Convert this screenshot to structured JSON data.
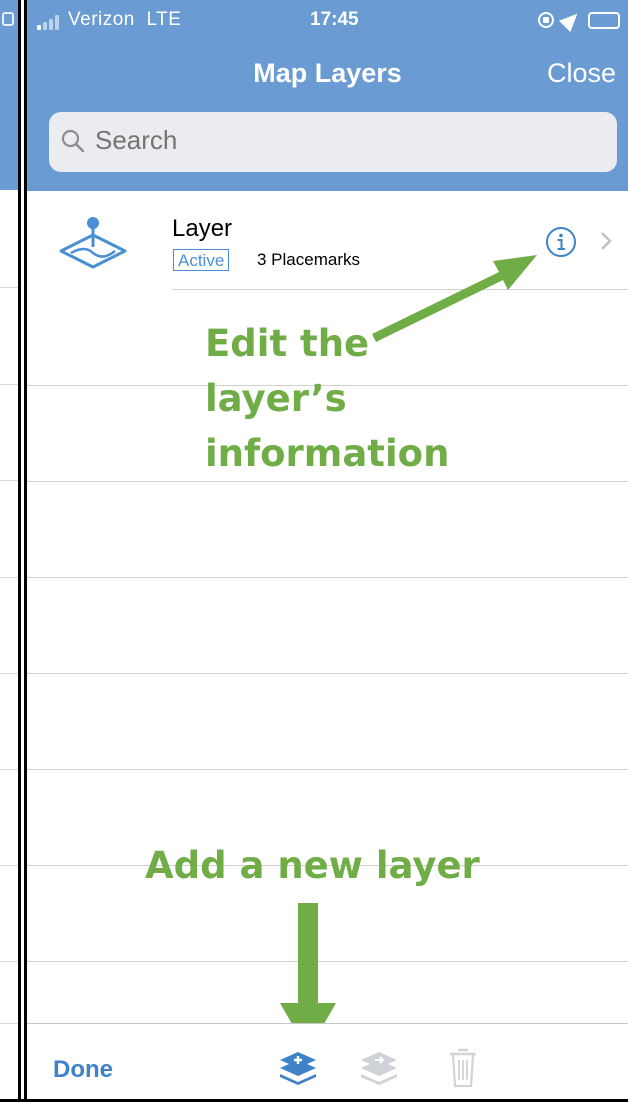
{
  "status_bar": {
    "carrier": "Verizon",
    "network": "LTE",
    "time": "17:45"
  },
  "nav": {
    "title": "Map Layers",
    "close_label": "Close"
  },
  "search": {
    "placeholder": "Search"
  },
  "layers": [
    {
      "name": "Layer",
      "badge": "Active",
      "count": "3 Placemarks"
    }
  ],
  "annotations": {
    "edit_info": "Edit the layer’s information",
    "add_layer": "Add a new layer",
    "color": "#70ad47"
  },
  "toolbar": {
    "done_label": "Done",
    "icons": [
      "add-layer-icon",
      "layers-icon",
      "trash-icon"
    ]
  },
  "colors": {
    "header": "#6a9bd3",
    "accent": "#3f82c8",
    "annotation": "#70ad47"
  }
}
